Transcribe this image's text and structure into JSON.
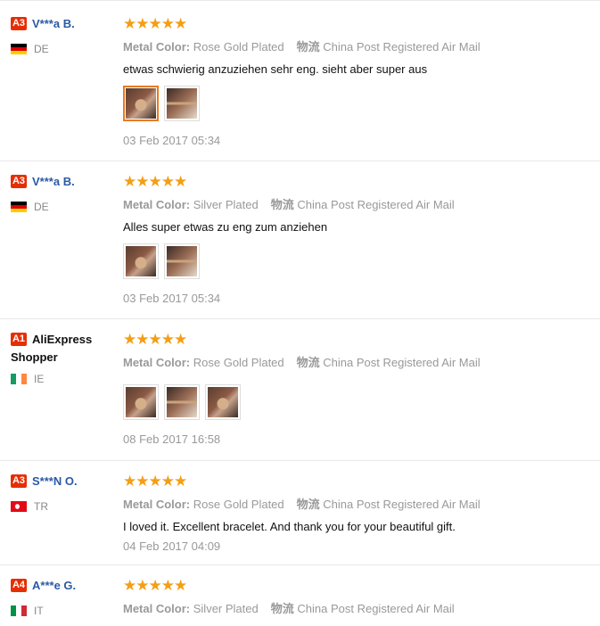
{
  "labels": {
    "metal_color": "Metal Color:",
    "shipping": "物流"
  },
  "reviews": [
    {
      "rank": "A3",
      "name": "V***a B.",
      "country": "DE",
      "stars": "★★★★★",
      "metal_color": "Rose Gold Plated",
      "shipping": "China Post Registered Air Mail",
      "comment": "etwas schwierig anzuziehen sehr eng. sieht aber super aus",
      "photos": 2,
      "date": "03 Feb 2017 05:34"
    },
    {
      "rank": "A3",
      "name": "V***a B.",
      "country": "DE",
      "stars": "★★★★★",
      "metal_color": "Silver Plated",
      "shipping": "China Post Registered Air Mail",
      "comment": "Alles super etwas zu eng zum anziehen",
      "photos": 2,
      "date": "03 Feb 2017 05:34"
    },
    {
      "rank": "A1",
      "name_line1": "AliExpress",
      "name_line2": "Shopper",
      "country": "IE",
      "stars": "★★★★★",
      "metal_color": "Rose Gold Plated",
      "shipping": "China Post Registered Air Mail",
      "comment": "",
      "photos": 3,
      "date": "08 Feb 2017 16:58"
    },
    {
      "rank": "A3",
      "name": "S***N O.",
      "country": "TR",
      "stars": "★★★★★",
      "metal_color": "Rose Gold Plated",
      "shipping": "China Post Registered Air Mail",
      "comment": "I loved it. Excellent bracelet. And thank you for your beautiful gift.",
      "photos": 0,
      "date": "04 Feb 2017 04:09"
    },
    {
      "rank": "A4",
      "name": "A***e G.",
      "country": "IT",
      "stars": "★★★★★",
      "metal_color": "Silver Plated",
      "shipping": "China Post Registered Air Mail",
      "comment": "",
      "photos": 0,
      "date": ""
    }
  ]
}
